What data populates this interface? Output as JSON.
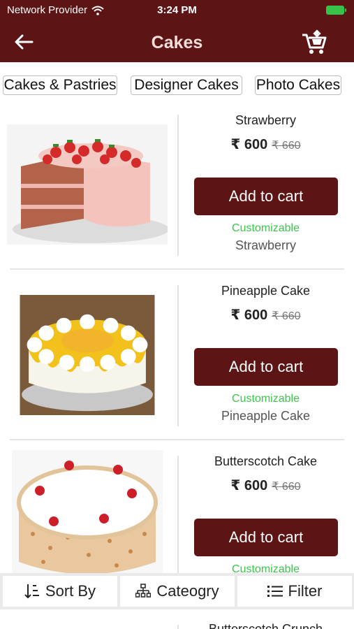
{
  "status_bar": {
    "carrier": "Network Provider",
    "time": "3:24 PM"
  },
  "header": {
    "title": "Cakes"
  },
  "tabs": [
    {
      "label": "Cakes & Pastries"
    },
    {
      "label": "Designer Cakes"
    },
    {
      "label": "Photo Cakes"
    }
  ],
  "products": [
    {
      "name": "Strawberry",
      "price": "₹ 600",
      "old_price": "₹ 660",
      "button": "Add to cart",
      "customizable": "Customizable",
      "flavour": "Strawberry"
    },
    {
      "name": "Pineapple Cake",
      "price": "₹ 600",
      "old_price": "₹ 660",
      "button": "Add to cart",
      "customizable": "Customizable",
      "flavour": "Pineapple Cake"
    },
    {
      "name": "Butterscotch Cake",
      "price": "₹ 600",
      "old_price": "₹ 660",
      "button": "Add to cart",
      "customizable": "Customizable",
      "flavour": ""
    },
    {
      "name": "Butterscotch Crunch"
    }
  ],
  "bottom_bar": {
    "sort": "Sort By",
    "category": "Cateogry",
    "filter": "Filter"
  },
  "colors": {
    "brand": "#5c1414",
    "customizable": "#3cc54a",
    "title_text": "#f6dcd8"
  }
}
